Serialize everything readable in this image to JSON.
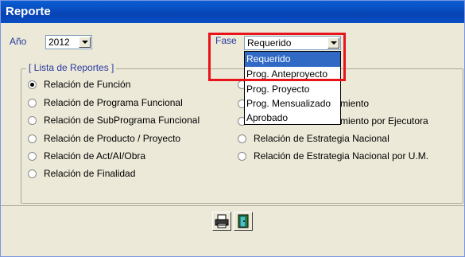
{
  "window": {
    "title": "Reporte"
  },
  "anio": {
    "label": "Año",
    "value": "2012"
  },
  "fase": {
    "label": "Fase",
    "value": "Requerido",
    "options": [
      "Requerido",
      "Prog. Anteproyecto",
      "Prog. Proyecto",
      "Prog. Mensualizado",
      "Aprobado"
    ]
  },
  "group": {
    "title": "[ Lista de Reportes ]"
  },
  "left_reports": [
    "Relación de Función",
    "Relación de Programa Funcional",
    "Relación de SubPrograma Funcional",
    "Relación de Producto / Proyecto",
    "Relación de Act/AI/Obra",
    "Relación de Finalidad"
  ],
  "right_reports": [
    "miento",
    "miento por Ejecutora",
    "Relación de Estrategia Nacional",
    "Relación de Estrategia Nacional por U.M."
  ],
  "selected_report": "Relación de Función",
  "icons": {
    "print": "printer-icon",
    "exit": "exit-door-icon"
  },
  "colors": {
    "titlebar": "#0743b3",
    "highlight": "#e8131b",
    "selection": "#316ac5"
  }
}
